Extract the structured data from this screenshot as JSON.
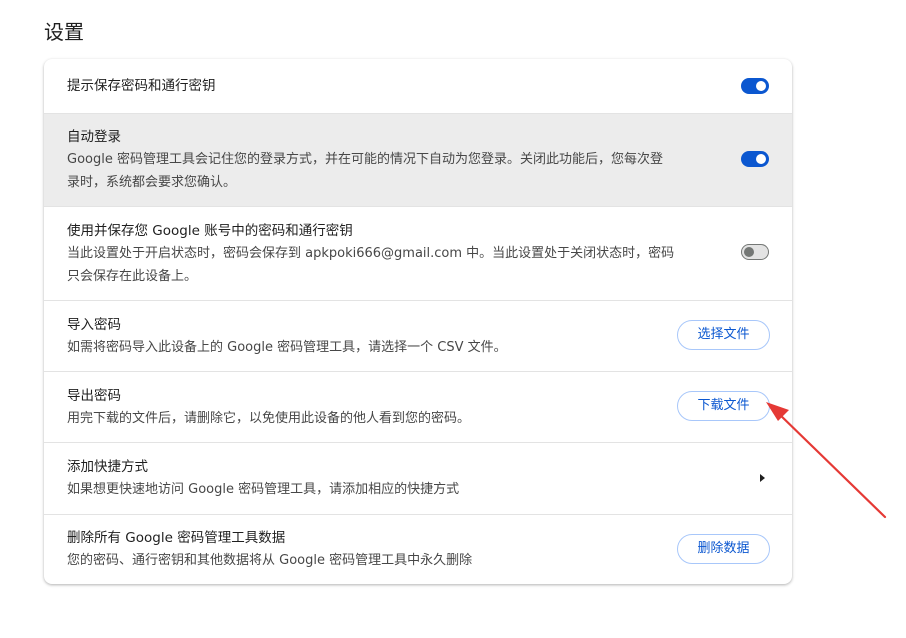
{
  "page": {
    "title": "设置"
  },
  "settings": {
    "offer_save": {
      "title": "提示保存密码和通行密钥",
      "enabled": true
    },
    "auto_signin": {
      "title": "自动登录",
      "desc_line1": "Google 密码管理工具会记住您的登录方式，并在可能的情况下自动为您登录。关闭此功能后，您每次登",
      "desc_line2": "录时，系统都会要求您确认。",
      "enabled": true
    },
    "account_storage": {
      "title": "使用并保存您 Google 账号中的密码和通行密钥",
      "desc_line1": "当此设置处于开启状态时，密码会保存到 apkpoki666@gmail.com 中。当此设置处于关闭状态时，密码",
      "desc_line2": "只会保存在此设备上。",
      "enabled": false
    },
    "import": {
      "title": "导入密码",
      "desc": "如需将密码导入此设备上的 Google 密码管理工具，请选择一个 CSV 文件。",
      "button_label": "选择文件"
    },
    "export": {
      "title": "导出密码",
      "desc": "用完下载的文件后，请删除它，以免使用此设备的他人看到您的密码。",
      "button_label": "下载文件"
    },
    "shortcut": {
      "title": "添加快捷方式",
      "desc": "如果想更快速地访问 Google 密码管理工具，请添加相应的快捷方式"
    },
    "delete_all": {
      "title": "删除所有 Google 密码管理工具数据",
      "desc": "您的密码、通行密钥和其他数据将从 Google 密码管理工具中永久删除",
      "button_label": "删除数据"
    }
  },
  "annotation": {
    "color": "#e53935",
    "icon": "red-arrow-pointing-to-download-button"
  },
  "colors": {
    "accent": "#0b57d0",
    "highlight_row": "#ececec"
  }
}
